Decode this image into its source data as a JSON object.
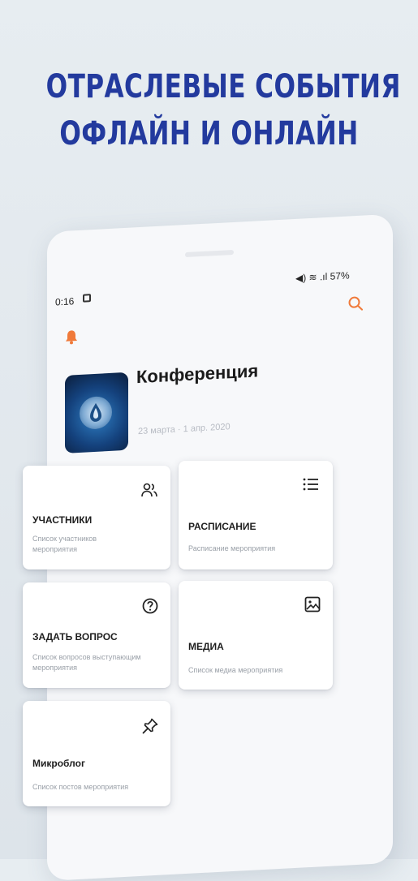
{
  "headline": {
    "line1": "ОТРАСЛЕВЫЕ СОБЫТИЯ",
    "line2": "ОФЛАЙН И ОНЛАЙН"
  },
  "status_bar": {
    "time": "0:16",
    "right": "◀) ≋ .ıl 57%"
  },
  "event": {
    "title": "Конференция",
    "dates": "23 марта · 1 апр. 2020"
  },
  "cards": [
    {
      "title": "УЧАСТНИКИ",
      "desc": "Список участников мероприятия",
      "icon": "people-icon"
    },
    {
      "title": "РАСПИСАНИЕ",
      "desc": "Расписание мероприятия",
      "icon": "list-icon"
    },
    {
      "title": "ЗАДАТЬ ВОПРОС",
      "desc": "Список вопросов выступающим мероприятия",
      "icon": "question-icon"
    },
    {
      "title": "МЕДИА",
      "desc": "Список медиа мероприятия",
      "icon": "image-icon"
    },
    {
      "title": "Микроблог",
      "desc": "Список постов мероприятия",
      "icon": "pin-icon"
    }
  ],
  "colors": {
    "headline": "#233a9e",
    "accent": "#f07a3a",
    "background": "#e5ebf0"
  }
}
